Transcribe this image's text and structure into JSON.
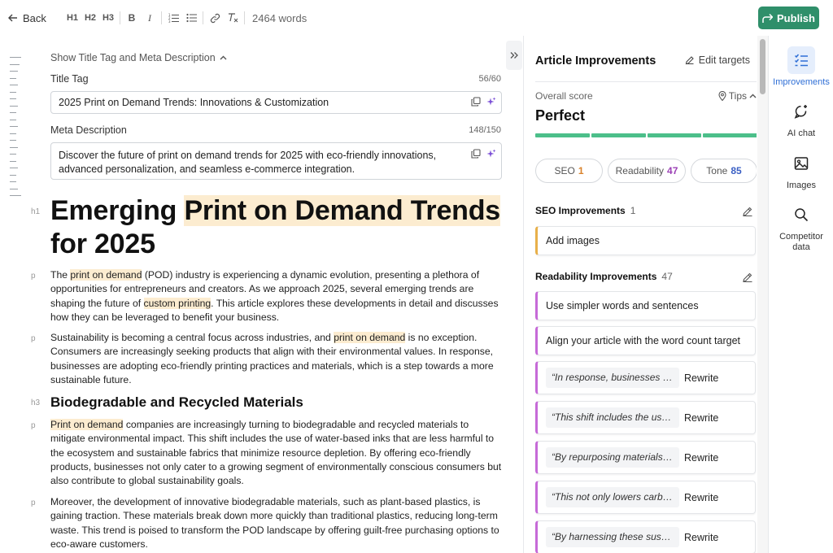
{
  "toolbar": {
    "back_label": "Back",
    "h1": "H1",
    "h2": "H2",
    "h3": "H3",
    "bold": "B",
    "italic": "I",
    "word_count": "2464 words",
    "publish_label": "Publish"
  },
  "meta": {
    "toggle_label": "Show Title Tag and Meta Description",
    "title_label": "Title Tag",
    "title_count": "56/60",
    "title_value": "2025 Print on Demand Trends: Innovations & Customization",
    "desc_label": "Meta Description",
    "desc_count": "148/150",
    "desc_value": "Discover the future of print on demand trends for 2025 with eco-friendly innovations, advanced personalization, and seamless e-commerce integration."
  },
  "article": {
    "tags": {
      "h1": "h1",
      "p": "p",
      "h3": "h3"
    },
    "h1_part1": "Emerging ",
    "h1_highlight": "Print on Demand Trends",
    "h1_part2": " for 2025",
    "p1": {
      "a": "The ",
      "hl1": "print on demand",
      "b": " (POD) industry is experiencing a dynamic evolution, presenting a plethora of opportunities for entrepreneurs and creators. As we approach 2025, several emerging trends are shaping the future of ",
      "hl2": "custom printing",
      "c": ". This article explores these developments in detail and discusses how they can be leveraged to benefit your business."
    },
    "p2": {
      "a": "Sustainability is becoming a central focus across industries, and ",
      "hl1": "print on demand",
      "b": " is no exception. Consumers are increasingly seeking products that align with their environmental values. In response, businesses are adopting eco-friendly printing practices and materials, which is a step towards a more sustainable future."
    },
    "h3": "Biodegradable and Recycled Materials",
    "p3": {
      "hl1": "Print on demand",
      "a": " companies are increasingly turning to biodegradable and recycled materials to mitigate environmental impact. This shift includes the use of water-based inks that are less harmful to the ecosystem and sustainable fabrics that minimize resource depletion. By offering eco-friendly products, businesses not only cater to a growing segment of environmentally conscious consumers but also contribute to global sustainability goals."
    },
    "p4": "Moreover, the development of innovative biodegradable materials, such as plant-based plastics, is gaining traction. These materials break down more quickly than traditional plastics, reducing long-term waste. This trend is poised to transform the POD landscape by offering guilt-free purchasing options to eco-aware customers."
  },
  "panel": {
    "title": "Article Improvements",
    "edit_targets": "Edit targets",
    "overall_label": "Overall score",
    "tips_label": "Tips",
    "score_word": "Perfect",
    "pills": [
      {
        "label": "SEO",
        "value": "1"
      },
      {
        "label": "Readability",
        "value": "47"
      },
      {
        "label": "Tone",
        "value": "85"
      }
    ],
    "seo_title": "SEO Improvements",
    "seo_count": "1",
    "seo_items": [
      "Add images"
    ],
    "read_title": "Readability Improvements",
    "read_count": "47",
    "read_items": [
      "Use simpler words and sentences",
      "Align your article with the word count target"
    ],
    "rewrite_label": "Rewrite",
    "rewrite_quotes": [
      "“In response, businesses a...",
      "“This shift includes the use...",
      "“By repurposing materials ...",
      "“This not only lowers carbo...",
      "“By harnessing these susta..."
    ]
  },
  "rail": {
    "items": [
      {
        "label": "Improvements",
        "icon": "checklist-icon"
      },
      {
        "label": "AI chat",
        "icon": "chat-icon"
      },
      {
        "label": "Images",
        "icon": "image-icon"
      },
      {
        "label": "Competitor data",
        "icon": "search-icon"
      }
    ]
  },
  "colors": {
    "publish": "#2f8f6a",
    "score_bar": "#4cbf8a",
    "highlight": "#fcecd0",
    "seo_accent": "#e8b04a",
    "readability_accent": "#c66ad8",
    "active_rail": "#2f6fd6"
  }
}
